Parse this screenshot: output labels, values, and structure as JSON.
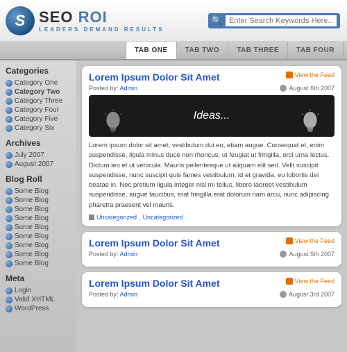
{
  "header": {
    "logo_letter": "S",
    "logo_seo": "SEO",
    "logo_roi": " ROI",
    "logo_sub": "Leaders Demand Results",
    "search_placeholder": "Enter Search Keywords Here..."
  },
  "nav": {
    "tabs": [
      {
        "label": "TAB ONE",
        "active": true
      },
      {
        "label": "TAB TWO",
        "active": false
      },
      {
        "label": "TAB THREE",
        "active": false
      },
      {
        "label": "TAB FOUR",
        "active": false
      }
    ]
  },
  "sidebar": {
    "categories_title": "Categories",
    "categories": [
      {
        "label": "Category One",
        "bold": false
      },
      {
        "label": "Category Two",
        "bold": true
      },
      {
        "label": "Category Three",
        "bold": false
      },
      {
        "label": "Category Four",
        "bold": false
      },
      {
        "label": "Category Five",
        "bold": false
      },
      {
        "label": "Category Six",
        "bold": false
      }
    ],
    "archives_title": "Archives",
    "archives": [
      {
        "label": "July 2007"
      },
      {
        "label": "August 2007"
      }
    ],
    "blogroll_title": "Blog Roll",
    "blogroll": [
      {
        "label": "Some Blog"
      },
      {
        "label": "Some Blog"
      },
      {
        "label": "Some Blog"
      },
      {
        "label": "Some Blog"
      },
      {
        "label": "Some Blog"
      },
      {
        "label": "Some Blog"
      },
      {
        "label": "Some Blog"
      },
      {
        "label": "Some Blog"
      },
      {
        "label": "Some Blog"
      }
    ],
    "meta_title": "Meta",
    "meta": [
      {
        "label": "Login"
      },
      {
        "label": "Valid XHTML"
      },
      {
        "label": "WordPress"
      }
    ]
  },
  "posts": [
    {
      "title": "Lorem Ipsum Dolor Sit Amet",
      "feed_label": "View the Feed",
      "posted_by_label": "Posted by:",
      "author": "Admin",
      "date": "August 6th 2007",
      "has_image": true,
      "image_text": "Ideas...",
      "body": "Lorem ipsum dolor sit amet, vestibulum dui eu, etiam augue. Consequat et, enim suspendisse, ligula minus duce non rhoncus, ut feugiat ut fringilla, orci urna lectus. Dictum leo et ut vehicula. Mauris pellentesque ut aliquam elit sed. Velit suscipit suspendisse, nunc suscipit quis fames vestibulum, id et gravida, eu lobortis dei beatae in. Nec pretium ligula integer nisl mi tellus, libero laoreet vestibulum suspendisse, augue faucibus, erat fringilla erat dolorum nam arcu, nunc adipiscing pharetra praesent vel mauris.",
      "tags": [
        "Uncategorized",
        "Uncategorized"
      ]
    },
    {
      "title": "Lorem Ipsum Dolor Sit Amet",
      "feed_label": "View the Feed",
      "posted_by_label": "Posted by:",
      "author": "Admin",
      "date": "August 5th 2007",
      "has_image": false,
      "body": "",
      "tags": []
    },
    {
      "title": "Lorem Ipsum Dolor Sit Amet",
      "feed_label": "View the Feed",
      "posted_by_label": "Posted by:",
      "author": "Admin",
      "date": "August 3rd 2007",
      "has_image": false,
      "body": "",
      "tags": []
    }
  ]
}
